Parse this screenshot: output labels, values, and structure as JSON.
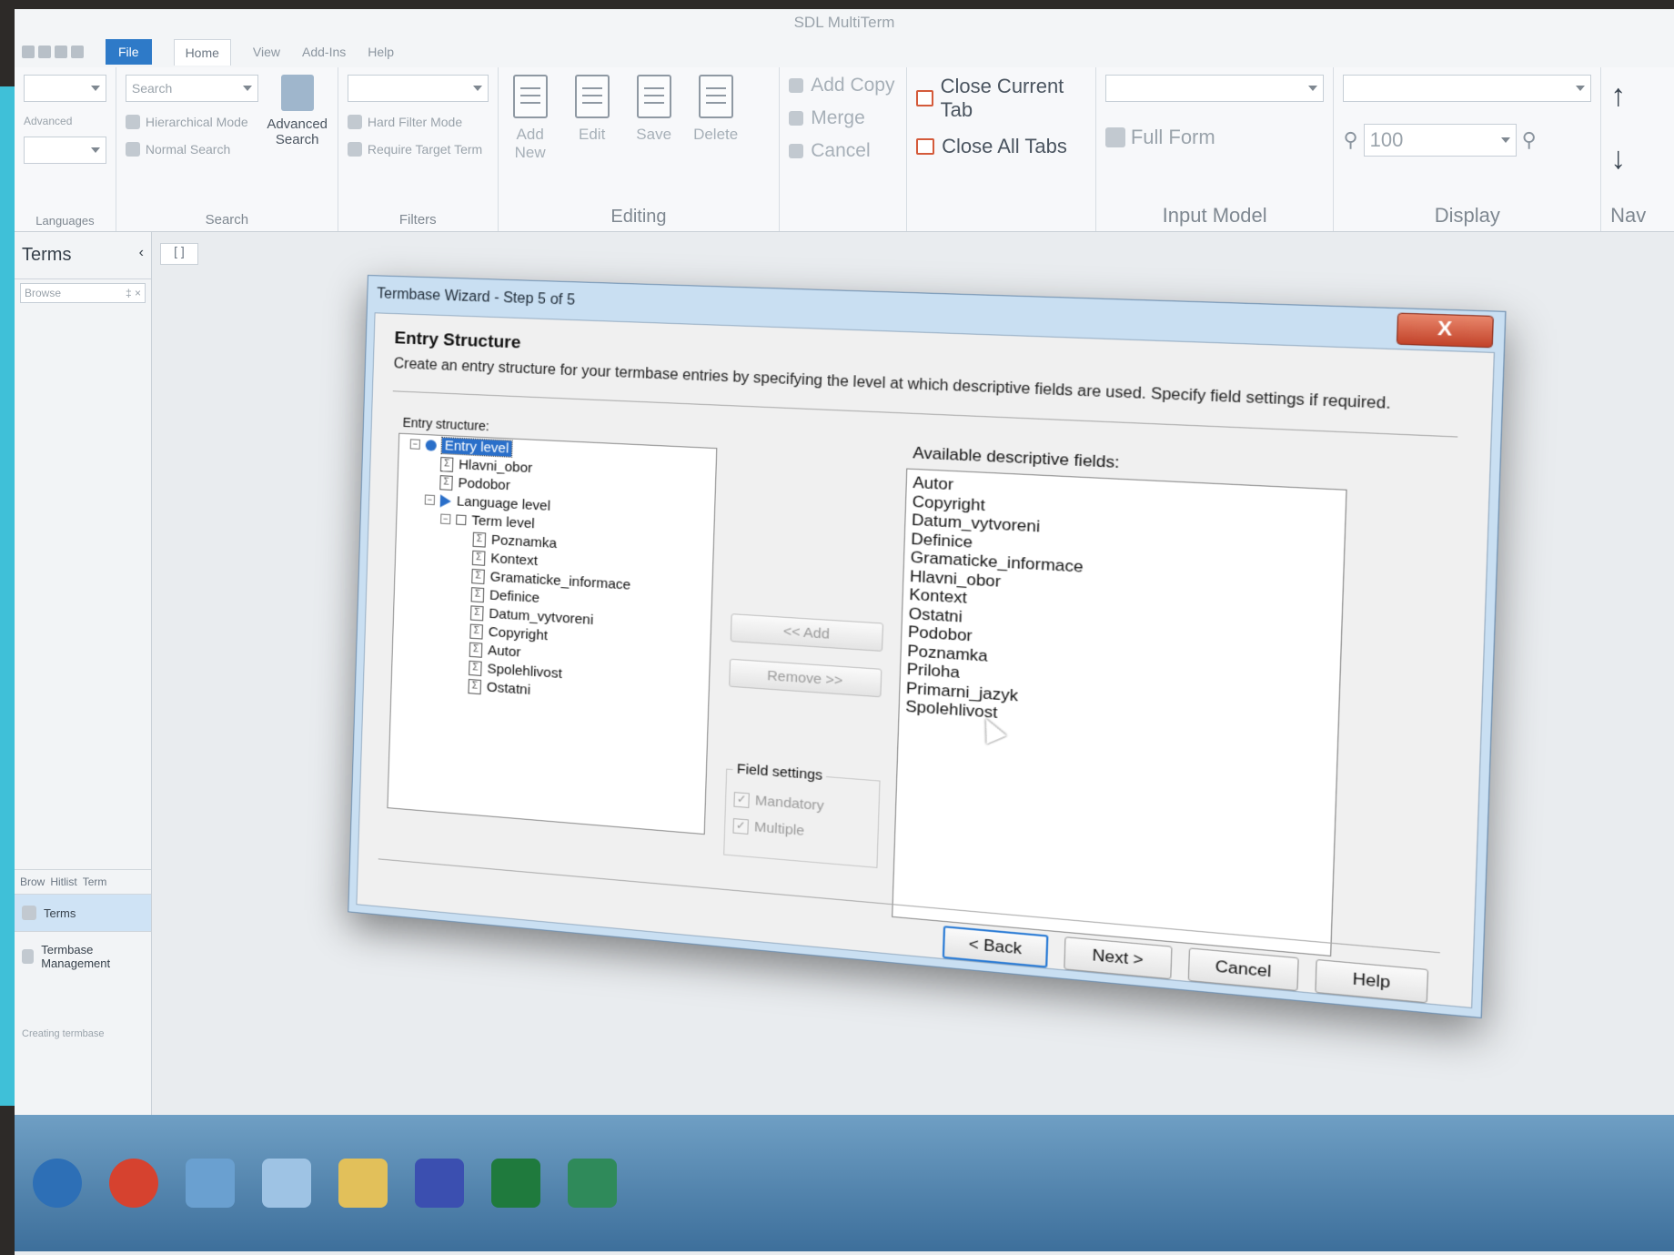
{
  "window": {
    "title": "SDL MultiTerm"
  },
  "menu": {
    "tabs": [
      "File",
      "Home",
      "View",
      "Add-Ins",
      "Help"
    ]
  },
  "ribbon": {
    "languages": {
      "label": "Languages",
      "row2": "Advanced"
    },
    "search": {
      "label": "Search",
      "placeholder": "Search",
      "hierarchical_mode": "Hierarchical Mode",
      "normal_search": "Normal Search",
      "advanced_search": "Advanced Search"
    },
    "filters": {
      "label": "Filters",
      "hard_filter_mode": "Hard Filter Mode",
      "require_target_term": "Require Target Term"
    },
    "editing": {
      "label": "Editing",
      "add_new": "Add New",
      "edit": "Edit",
      "save": "Save",
      "delete": "Delete",
      "add_copy": "Add Copy",
      "merge": "Merge",
      "cancel": "Cancel"
    },
    "tabs": {
      "close_current": "Close Current Tab",
      "close_all": "Close All Tabs"
    },
    "input_model": {
      "label": "Input Model",
      "full_form": "Full Form"
    },
    "display": {
      "label": "Display",
      "zoom": "100"
    },
    "nav": {
      "label": "Nav"
    }
  },
  "left_pane": {
    "title": "Terms",
    "browse": "Browse",
    "tabs": [
      "Brow",
      "Hitlist",
      "Term"
    ],
    "buttons": [
      "Terms",
      "Termbase Management"
    ],
    "status": "Creating termbase"
  },
  "doc_tab": "[ ]",
  "dialog": {
    "title": "Termbase Wizard - Step 5 of 5",
    "close": "X",
    "header_title": "Entry Structure",
    "header_desc": "Create an entry structure for your termbase entries by specifying the level at which descriptive fields are used. Specify field settings if required.",
    "entry_structure_label": "Entry structure:",
    "tree": {
      "entry_level": "Entry level",
      "entry_fields": [
        "Hlavni_obor",
        "Podobor"
      ],
      "language_level": "Language level",
      "term_level": "Term level",
      "term_fields": [
        "Poznamka",
        "Kontext",
        "Gramaticke_informace",
        "Definice",
        "Datum_vytvoreni",
        "Copyright",
        "Autor",
        "Spolehlivost",
        "Ostatni"
      ]
    },
    "add_button": "<< Add",
    "remove_button": "Remove >>",
    "field_settings": {
      "legend": "Field settings",
      "mandatory": "Mandatory",
      "multiple": "Multiple"
    },
    "available_label": "Available descriptive fields:",
    "available_fields": [
      "Autor",
      "Copyright",
      "Datum_vytvoreni",
      "Definice",
      "Gramaticke_informace",
      "Hlavni_obor",
      "Kontext",
      "Ostatni",
      "Podobor",
      "Poznamka",
      "Priloha",
      "Primarni_jazyk",
      "Spolehlivost"
    ],
    "buttons": {
      "back": "< Back",
      "next": "Next >",
      "cancel": "Cancel",
      "help": "Help"
    }
  }
}
